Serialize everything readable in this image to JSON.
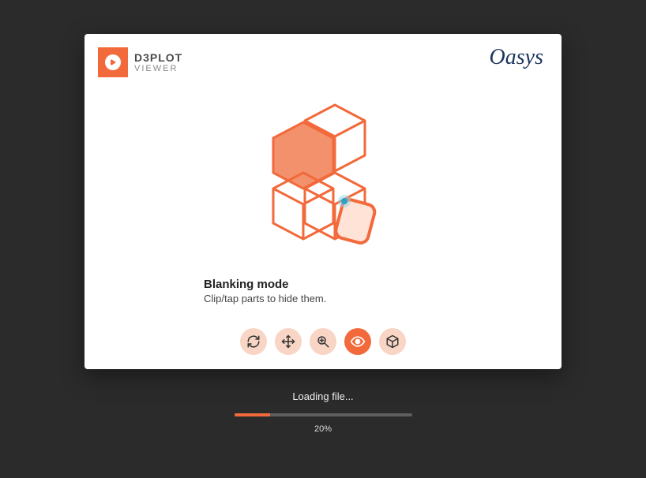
{
  "header": {
    "app_name": "D3PLOT",
    "app_sub": "VIEWER",
    "vendor": "Oasys"
  },
  "hint": {
    "title": "Blanking mode",
    "text": "Clip/tap parts to hide them."
  },
  "toolbar": {
    "rotate_icon": "rotate-icon",
    "pan_icon": "pan-icon",
    "zoom_icon": "zoom-icon",
    "eye_icon": "eye-icon",
    "cube_icon": "cube-icon"
  },
  "loading": {
    "label": "Loading file...",
    "percent_text": "20%",
    "percent_value": 20
  },
  "colors": {
    "accent": "#f26a3b",
    "tool_bg": "#f8d5c4",
    "page_bg": "#2b2b2b"
  }
}
